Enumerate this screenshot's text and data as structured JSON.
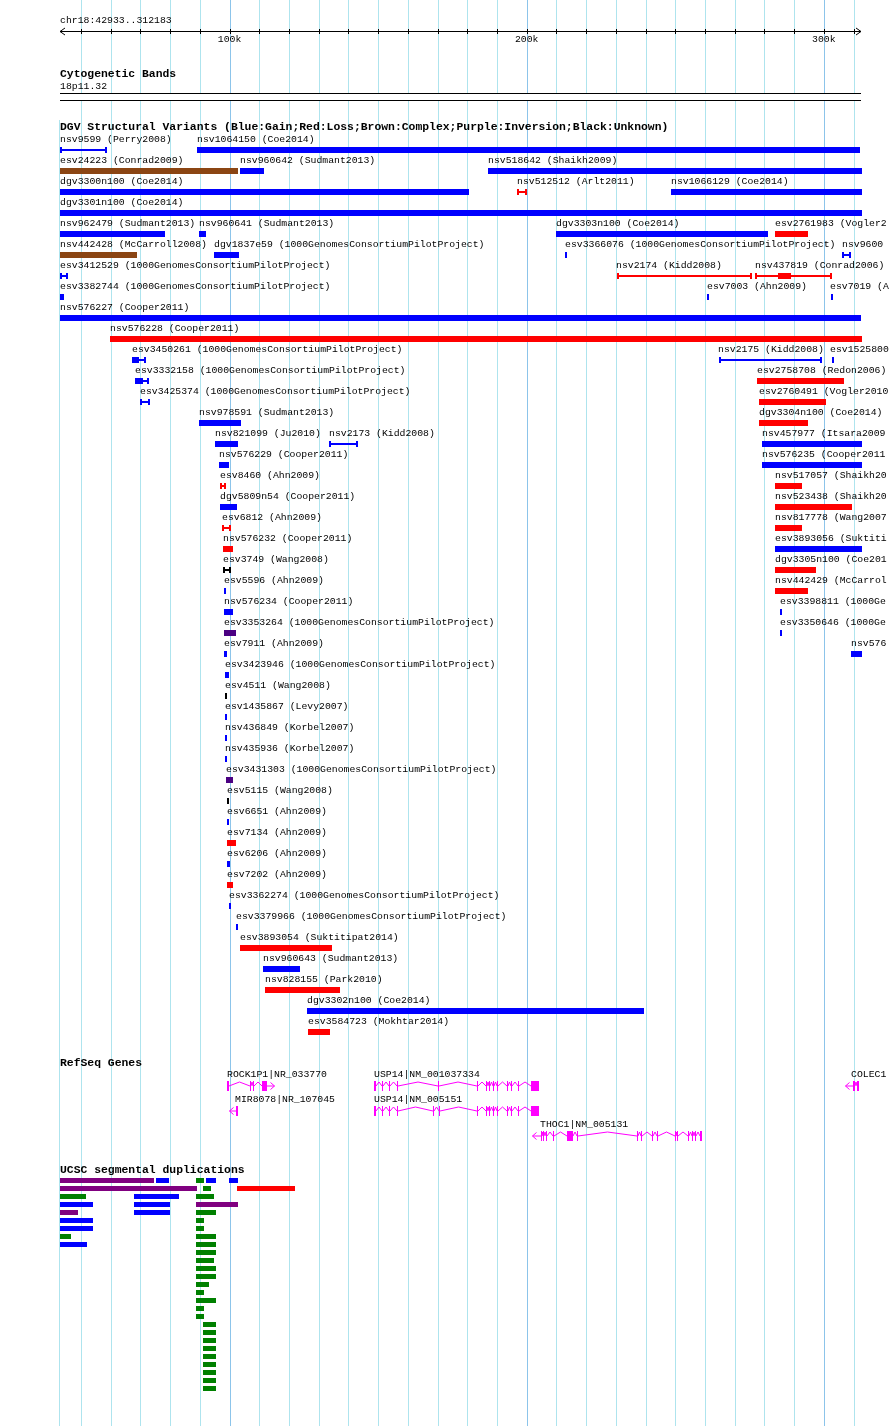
{
  "ruler": {
    "range": "chr18:42933..312183",
    "ticks": [
      "100k",
      "200k",
      "300k"
    ]
  },
  "cytogenetic_bands": {
    "title": "Cytogenetic Bands",
    "band": "18p11.32"
  },
  "dgv_structural_variants": {
    "title": "DGV Structural Variants (Blue:Gain;Red:Loss;Brown:Complex;Purple:Inversion;Black:Unknown)",
    "rows": [
      {
        "variants": [
          {
            "label": "nsv9599 (Perry2008)",
            "color": "#0000ff",
            "kind": "interval"
          },
          {
            "label": "nsv1064150 (Coe2014)",
            "color": "#0000ff",
            "kind": "bar"
          }
        ]
      },
      {
        "variants": [
          {
            "label": "esv24223 (Conrad2009)",
            "color": "#8b4513",
            "kind": "bar"
          },
          {
            "label": "nsv960642 (Sudmant2013)",
            "color": "#0000ff",
            "kind": "bar"
          },
          {
            "label": "nsv518642 (Shaikh2009)",
            "color": "#0000ff",
            "kind": "bar"
          }
        ]
      },
      {
        "variants": [
          {
            "label": "dgv3300n100 (Coe2014)",
            "color": "#0000ff",
            "kind": "bar"
          },
          {
            "label": "nsv512512 (Arlt2011)",
            "color": "#ff0000",
            "kind": "interval"
          },
          {
            "label": "nsv1066129 (Coe2014)",
            "color": "#0000ff",
            "kind": "bar"
          }
        ]
      },
      {
        "variants": [
          {
            "label": "dgv3301n100 (Coe2014)",
            "color": "#0000ff",
            "kind": "bar"
          }
        ]
      },
      {
        "variants": [
          {
            "label": "nsv962479 (Sudmant2013)",
            "color": "#0000ff",
            "kind": "bar"
          },
          {
            "label": "nsv960641 (Sudmant2013)",
            "color": "#0000ff",
            "kind": "bar"
          },
          {
            "label": "dgv3303n100 (Coe2014)",
            "color": "#0000ff",
            "kind": "bar"
          },
          {
            "label": "esv2761983 (Vogler2",
            "color": "#ff0000",
            "kind": "bar"
          }
        ]
      },
      {
        "variants": [
          {
            "label": "nsv442428 (McCarroll2008)",
            "color": "#8b4513",
            "kind": "bar"
          },
          {
            "label": "dgv1837e59 (1000GenomesConsortiumPilotProject)",
            "color": "#0000ff",
            "kind": "bar"
          },
          {
            "label": "esv3366076 (1000GenomesConsortiumPilotProject)",
            "color": "#0000ff",
            "kind": "bar"
          },
          {
            "label": "nsv9600",
            "color": "#0000ff",
            "kind": "interval"
          }
        ]
      },
      {
        "variants": [
          {
            "label": "esv3412529 (1000GenomesConsortiumPilotProject)",
            "color": "#0000ff",
            "kind": "interval"
          },
          {
            "label": "nsv2174 (Kidd2008)",
            "color": "#ff0000",
            "kind": "interval"
          },
          {
            "label": "nsv437819 (Conrad2006)",
            "color": "#ff0000",
            "kind": "interval"
          }
        ]
      },
      {
        "variants": [
          {
            "label": "esv3382744 (1000GenomesConsortiumPilotProject)",
            "color": "#0000ff",
            "kind": "interval"
          },
          {
            "label": "esv7003 (Ahn2009)",
            "color": "#0000ff",
            "kind": "bar"
          },
          {
            "label": "esv7019 (A",
            "color": "#0000ff",
            "kind": "bar"
          }
        ]
      },
      {
        "variants": [
          {
            "label": "nsv576227 (Cooper2011)",
            "color": "#0000ff",
            "kind": "bar"
          }
        ]
      },
      {
        "variants": [
          {
            "label": "nsv576228 (Cooper2011)",
            "color": "#ff0000",
            "kind": "bar"
          }
        ]
      },
      {
        "variants": [
          {
            "label": "esv3450261 (1000GenomesConsortiumPilotProject)",
            "color": "#0000ff",
            "kind": "interval"
          },
          {
            "label": "nsv2175 (Kidd2008)",
            "color": "#0000ff",
            "kind": "interval"
          },
          {
            "label": "esv1525800",
            "color": "#0000ff",
            "kind": "bar"
          }
        ]
      },
      {
        "variants": [
          {
            "label": "esv3332158 (1000GenomesConsortiumPilotProject)",
            "color": "#0000ff",
            "kind": "interval"
          },
          {
            "label": "esv2758708 (Redon2006)",
            "color": "#ff0000",
            "kind": "bar"
          }
        ]
      },
      {
        "variants": [
          {
            "label": "esv3425374 (1000GenomesConsortiumPilotProject)",
            "color": "#0000ff",
            "kind": "interval"
          },
          {
            "label": "esv2760491 (Vogler2010",
            "color": "#ff0000",
            "kind": "bar"
          }
        ]
      },
      {
        "variants": [
          {
            "label": "nsv978591 (Sudmant2013)",
            "color": "#0000ff",
            "kind": "bar"
          },
          {
            "label": "dgv3304n100 (Coe2014)",
            "color": "#ff0000",
            "kind": "bar"
          }
        ]
      },
      {
        "variants": [
          {
            "label": "nsv821099 (Ju2010)",
            "color": "#0000ff",
            "kind": "bar"
          },
          {
            "label": "nsv2173 (Kidd2008)",
            "color": "#0000ff",
            "kind": "interval"
          },
          {
            "label": "nsv457977 (Itsara2009",
            "color": "#0000ff",
            "kind": "bar"
          }
        ]
      },
      {
        "variants": [
          {
            "label": "nsv576229 (Cooper2011)",
            "color": "#0000ff",
            "kind": "bar"
          },
          {
            "label": "nsv576235 (Cooper2011",
            "color": "#0000ff",
            "kind": "bar"
          }
        ]
      },
      {
        "variants": [
          {
            "label": "esv8460 (Ahn2009)",
            "color": "#ff0000",
            "kind": "interval"
          },
          {
            "label": "nsv517057 (Shaikh20",
            "color": "#ff0000",
            "kind": "bar"
          }
        ]
      },
      {
        "variants": [
          {
            "label": "dgv5809n54 (Cooper2011)",
            "color": "#0000ff",
            "kind": "bar"
          },
          {
            "label": "nsv523438 (Shaikh20",
            "color": "#ff0000",
            "kind": "bar"
          }
        ]
      },
      {
        "variants": [
          {
            "label": "esv6812 (Ahn2009)",
            "color": "#ff0000",
            "kind": "interval"
          },
          {
            "label": "nsv817778 (Wang2007",
            "color": "#ff0000",
            "kind": "bar"
          }
        ]
      },
      {
        "variants": [
          {
            "label": "nsv576232 (Cooper2011)",
            "color": "#ff0000",
            "kind": "bar"
          },
          {
            "label": "esv3893056 (Suktiti",
            "color": "#0000ff",
            "kind": "bar"
          }
        ]
      },
      {
        "variants": [
          {
            "label": "esv3749 (Wang2008)",
            "color": "#000000",
            "kind": "interval"
          },
          {
            "label": "dgv3305n100 (Coe201",
            "color": "#ff0000",
            "kind": "bar"
          }
        ]
      },
      {
        "variants": [
          {
            "label": "esv5596 (Ahn2009)",
            "color": "#0000ff",
            "kind": "bar"
          },
          {
            "label": "nsv442429 (McCarrol",
            "color": "#ff0000",
            "kind": "bar"
          }
        ]
      },
      {
        "variants": [
          {
            "label": "nsv576234 (Cooper2011)",
            "color": "#0000ff",
            "kind": "bar"
          },
          {
            "label": "esv3398811 (1000Ge",
            "color": "#0000ff",
            "kind": "bar"
          }
        ]
      },
      {
        "variants": [
          {
            "label": "esv3353264 (1000GenomesConsortiumPilotProject)",
            "color": "#4b0082",
            "kind": "bar"
          },
          {
            "label": "esv3350646 (1000Ge",
            "color": "#0000ff",
            "kind": "bar"
          }
        ]
      },
      {
        "variants": [
          {
            "label": "esv7911 (Ahn2009)",
            "color": "#0000ff",
            "kind": "bar"
          },
          {
            "label": "nsv576",
            "color": "#0000ff",
            "kind": "bar"
          }
        ]
      },
      {
        "variants": [
          {
            "label": "esv3423946 (1000GenomesConsortiumPilotProject)",
            "color": "#0000ff",
            "kind": "bar"
          }
        ]
      },
      {
        "variants": [
          {
            "label": "esv4511 (Wang2008)",
            "color": "#000000",
            "kind": "bar"
          }
        ]
      },
      {
        "variants": [
          {
            "label": "esv1435867 (Levy2007)",
            "color": "#0000ff",
            "kind": "bar"
          }
        ]
      },
      {
        "variants": [
          {
            "label": "nsv436849 (Korbel2007)",
            "color": "#0000ff",
            "kind": "bar"
          }
        ]
      },
      {
        "variants": [
          {
            "label": "nsv435936 (Korbel2007)",
            "color": "#0000ff",
            "kind": "bar"
          }
        ]
      },
      {
        "variants": [
          {
            "label": "esv3431303 (1000GenomesConsortiumPilotProject)",
            "color": "#4b0082",
            "kind": "bar"
          }
        ]
      },
      {
        "variants": [
          {
            "label": "esv5115 (Wang2008)",
            "color": "#000000",
            "kind": "bar"
          }
        ]
      },
      {
        "variants": [
          {
            "label": "esv6651 (Ahn2009)",
            "color": "#0000ff",
            "kind": "bar"
          }
        ]
      },
      {
        "variants": [
          {
            "label": "esv7134 (Ahn2009)",
            "color": "#ff0000",
            "kind": "bar"
          }
        ]
      },
      {
        "variants": [
          {
            "label": "esv6206 (Ahn2009)",
            "color": "#0000ff",
            "kind": "bar"
          }
        ]
      },
      {
        "variants": [
          {
            "label": "esv7202 (Ahn2009)",
            "color": "#ff0000",
            "kind": "bar"
          }
        ]
      },
      {
        "variants": [
          {
            "label": "esv3362274 (1000GenomesConsortiumPilotProject)",
            "color": "#0000ff",
            "kind": "bar"
          }
        ]
      },
      {
        "variants": [
          {
            "label": "esv3379966 (1000GenomesConsortiumPilotProject)",
            "color": "#0000ff",
            "kind": "bar"
          }
        ]
      },
      {
        "variants": [
          {
            "label": "esv3893054 (Suktitipat2014)",
            "color": "#ff0000",
            "kind": "bar"
          }
        ]
      },
      {
        "variants": [
          {
            "label": "nsv960643 (Sudmant2013)",
            "color": "#0000ff",
            "kind": "bar"
          }
        ]
      },
      {
        "variants": [
          {
            "label": "nsv828155 (Park2010)",
            "color": "#ff0000",
            "kind": "bar"
          }
        ]
      },
      {
        "variants": [
          {
            "label": "dgv3302n100 (Coe2014)",
            "color": "#0000ff",
            "kind": "bar"
          }
        ]
      },
      {
        "variants": [
          {
            "label": "esv3584723 (Mokhtar2014)",
            "color": "#ff0000",
            "kind": "bar"
          }
        ]
      }
    ]
  },
  "refseq_genes": {
    "title": "RefSeq Genes",
    "rows": [
      {
        "genes": [
          {
            "label": "ROCK1P1|NR_033770",
            "arrow_left": false,
            "arrow_right": true
          },
          {
            "label": "USP14|NM_001037334",
            "arrow_left": false,
            "arrow_right": false
          },
          {
            "label": "COLEC1",
            "arrow_left": true,
            "arrow_right": false
          }
        ]
      },
      {
        "genes": [
          {
            "label": "MIR8078|NR_107045",
            "arrow_left": true,
            "arrow_right": false
          },
          {
            "label": "USP14|NM_005151",
            "arrow_left": false,
            "arrow_right": false
          }
        ]
      },
      {
        "genes": [
          {
            "label": "THOC1|NM_005131",
            "arrow_left": true,
            "arrow_right": false
          }
        ]
      }
    ]
  },
  "segmental_duplications": {
    "title": "UCSC segmental duplications",
    "rows": [
      {
        "bars": [
          {
            "color": "#800080"
          },
          {
            "color": "#0000ff"
          },
          {
            "color": "#008000"
          },
          {
            "color": "#0000ff"
          },
          {
            "color": "#0000ff"
          }
        ]
      },
      {
        "bars": [
          {
            "color": "#800080"
          },
          {
            "color": "#008000"
          },
          {
            "color": "#ff0000"
          }
        ]
      },
      {
        "bars": [
          {
            "color": "#008000"
          },
          {
            "color": "#0000ff"
          },
          {
            "color": "#008000"
          }
        ]
      },
      {
        "bars": [
          {
            "color": "#0000ff"
          },
          {
            "color": "#0000ff"
          },
          {
            "color": "#800080"
          }
        ]
      },
      {
        "bars": [
          {
            "color": "#800080"
          },
          {
            "color": "#0000ff"
          },
          {
            "color": "#008000"
          }
        ]
      },
      {
        "bars": [
          {
            "color": "#0000ff"
          },
          {
            "color": "#008000"
          }
        ]
      },
      {
        "bars": [
          {
            "color": "#0000ff"
          },
          {
            "color": "#008000"
          }
        ]
      },
      {
        "bars": [
          {
            "color": "#008000"
          },
          {
            "color": "#008000"
          }
        ]
      },
      {
        "bars": [
          {
            "color": "#0000ff"
          },
          {
            "color": "#008000"
          }
        ]
      },
      {
        "bars": [
          {
            "color": "#008000"
          }
        ]
      },
      {
        "bars": [
          {
            "color": "#008000"
          }
        ]
      },
      {
        "bars": [
          {
            "color": "#008000"
          }
        ]
      },
      {
        "bars": [
          {
            "color": "#008000"
          }
        ]
      },
      {
        "bars": [
          {
            "color": "#008000"
          }
        ]
      },
      {
        "bars": [
          {
            "color": "#008000"
          }
        ]
      },
      {
        "bars": [
          {
            "color": "#008000"
          }
        ]
      },
      {
        "bars": [
          {
            "color": "#008000"
          }
        ]
      },
      {
        "bars": [
          {
            "color": "#008000"
          }
        ]
      },
      {
        "bars": [
          {
            "color": "#008000"
          }
        ]
      },
      {
        "bars": [
          {
            "color": "#008000"
          }
        ]
      },
      {
        "bars": [
          {
            "color": "#008000"
          }
        ]
      },
      {
        "bars": [
          {
            "color": "#008000"
          }
        ]
      },
      {
        "bars": [
          {
            "color": "#008000"
          }
        ]
      },
      {
        "bars": [
          {
            "color": "#008000"
          }
        ]
      },
      {
        "bars": [
          {
            "color": "#008000"
          }
        ]
      },
      {
        "bars": [
          {
            "color": "#008000"
          }
        ]
      },
      {
        "bars": [
          {
            "color": "#008000"
          }
        ]
      }
    ]
  }
}
